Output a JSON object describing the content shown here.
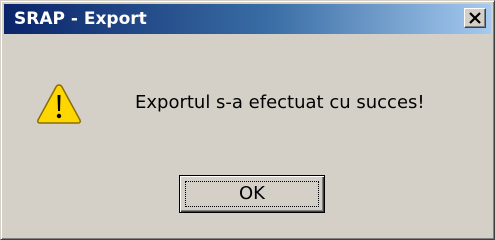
{
  "window": {
    "title": "SRAP - Export",
    "close_icon": "close-icon"
  },
  "dialog": {
    "icon": "warning-icon",
    "message": "Exportul s-a efectuat cu succes!",
    "ok_label": "OK"
  },
  "colors": {
    "titlebar_start": "#0a246a",
    "titlebar_end": "#a6caf0",
    "face": "#d4d0c8",
    "warning_fill": "#ffd700"
  }
}
